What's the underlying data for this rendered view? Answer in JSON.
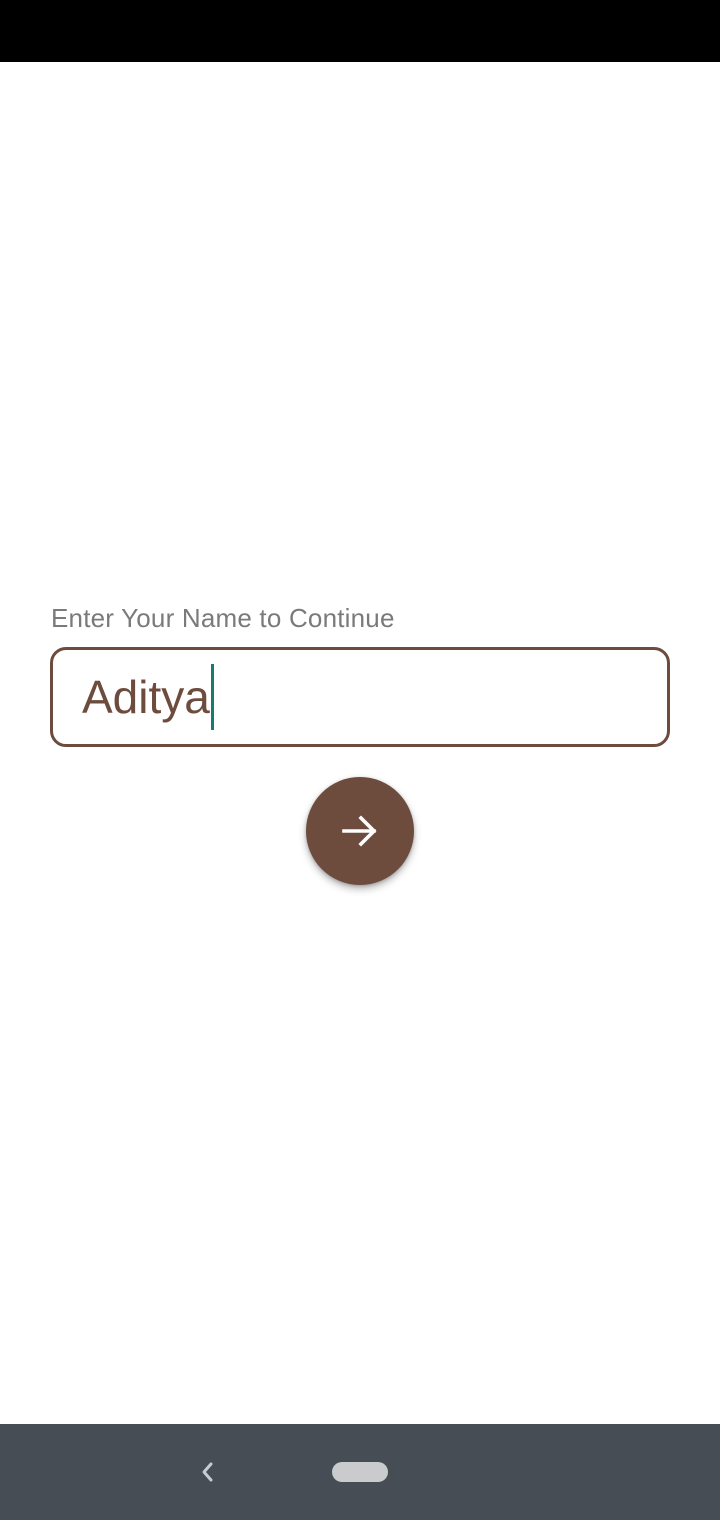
{
  "screen": {
    "prompt_label": "Enter Your Name to Continue",
    "name_field": {
      "value": "Aditya",
      "focused": true
    },
    "next_button": {
      "icon": "arrow-right-icon"
    }
  },
  "navigation_bar": {
    "back_icon": "chevron-left-icon",
    "home_icon": "home-pill-icon"
  },
  "colors": {
    "accent": "#6d4c3d",
    "caret": "#1a7a70",
    "label": "#7a7a7a",
    "nav_bar": "#474d55",
    "status_bar": "#000000"
  }
}
